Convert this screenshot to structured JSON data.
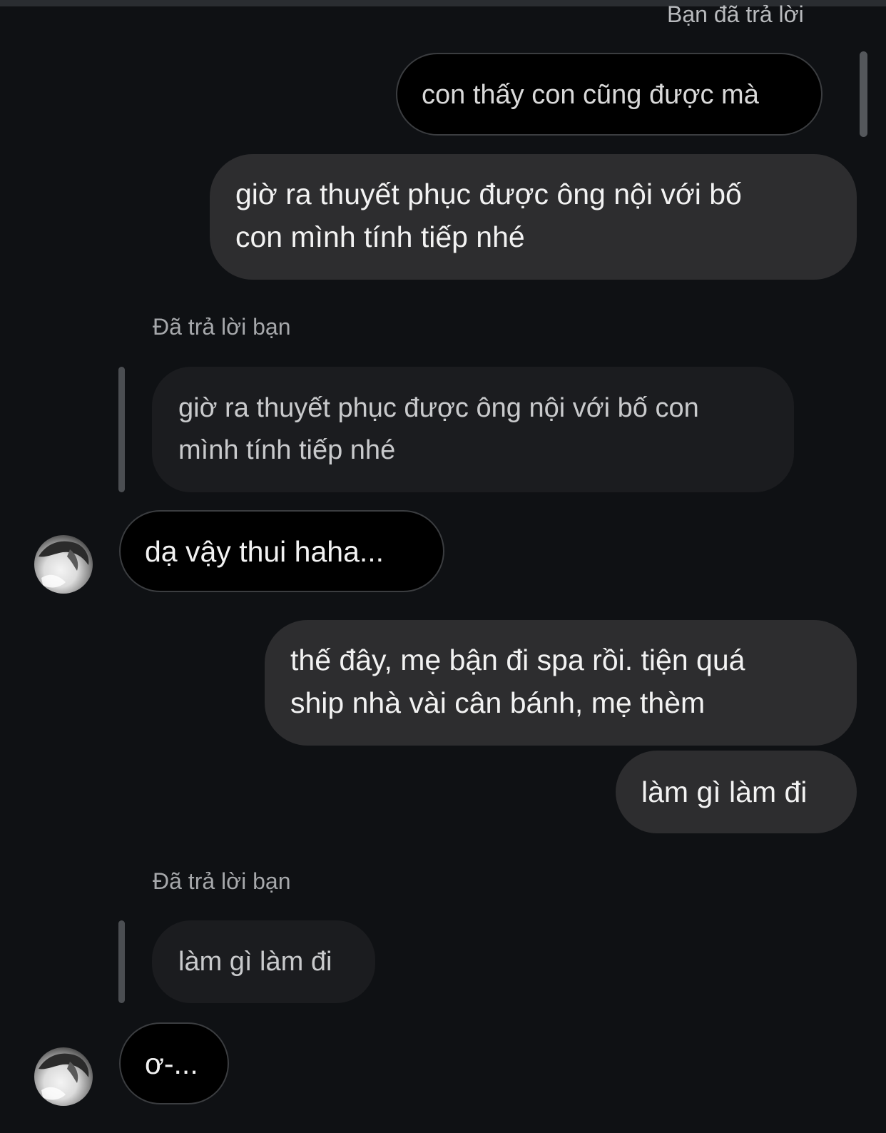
{
  "conversation": {
    "header_reply_meta": "Bạn đã trả lời",
    "messages": [
      {
        "id": "m1",
        "direction": "outgoing",
        "style": "outlined",
        "text": "con thấy con cũng được mà"
      },
      {
        "id": "m2",
        "direction": "outgoing",
        "style": "filled",
        "lines": [
          "giờ ra thuyết phục được ông nội với bố",
          "con mình tính tiếp nhé"
        ]
      },
      {
        "id": "m3",
        "direction": "incoming",
        "reply_meta": "Đã trả lời bạn",
        "quoted_lines": [
          "giờ ra thuyết phục được ông nội với bố con",
          "mình tính tiếp nhé"
        ],
        "text": "dạ vậy thui haha..."
      },
      {
        "id": "m4",
        "direction": "outgoing",
        "style": "filled",
        "lines": [
          "thế đây, mẹ bận đi spa rồi. tiện quá",
          "ship nhà vài cân bánh, mẹ thèm"
        ]
      },
      {
        "id": "m5",
        "direction": "outgoing",
        "style": "filled",
        "text": "làm gì làm đi"
      },
      {
        "id": "m6",
        "direction": "incoming",
        "reply_meta": "Đã trả lời bạn",
        "quoted_text": "làm gì làm đi",
        "text": "ơ-..."
      }
    ]
  },
  "avatar_icon": "user-avatar-photo",
  "colors": {
    "background": "#0f1114",
    "outgoing_bubble": "#2d2d2f",
    "incoming_bubble": "#000000",
    "quote_bubble": "#1b1c1f",
    "meta_text": "#a6a8ab"
  }
}
